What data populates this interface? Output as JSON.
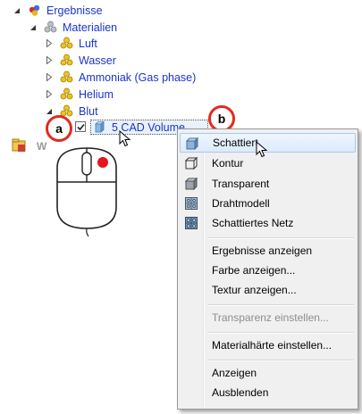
{
  "tree": {
    "root": "Ergebnisse",
    "materialien": "Materialien",
    "items": [
      "Luft",
      "Wasser",
      "Ammoniak (Gas phase)",
      "Helium",
      "Blut"
    ],
    "cad_volume": "5 CAD Volume",
    "partial_label": "W"
  },
  "callouts": {
    "a": "a",
    "b": "b"
  },
  "context_menu": {
    "display_items": [
      "Schattiert",
      "Kontur",
      "Transparent",
      "Drahtmodell",
      "Schattiertes Netz"
    ],
    "actions": [
      "Ergebnisse anzeigen",
      "Farbe anzeigen...",
      "Textur anzeigen..."
    ],
    "disabled_item": "Transparenz einstellen...",
    "hardness_item": "Materialhärte einstellen...",
    "visibility_items": [
      "Anzeigen",
      "Ausblenden"
    ],
    "highlighted": "Schattiert"
  },
  "colors": {
    "link_text": "#1a35c8",
    "callout_ring": "#e02b20",
    "menu_bg": "#f0f0f0",
    "mouse_button": "#e8141b"
  }
}
